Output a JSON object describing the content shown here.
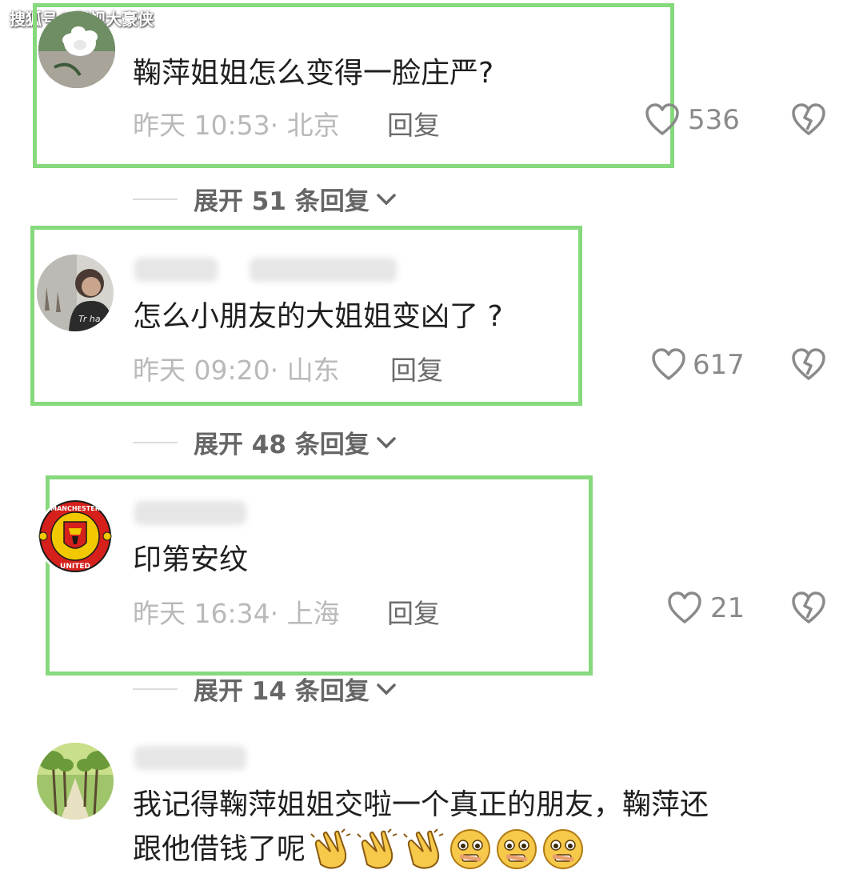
{
  "watermark": "搜狐号@影视大豪侠",
  "comments": [
    {
      "text": "鞠萍姐姐怎么变得一脸庄严?",
      "time": "昨天 10:53",
      "location": "北京",
      "reply_label": "回复",
      "likes": "536",
      "expand_label": "展开 51 条回复",
      "avatar": "white-flower-avatar"
    },
    {
      "text": "怎么小朋友的大姐姐变凶了 ?",
      "time": "昨天 09:20",
      "location": "山东",
      "reply_label": "回复",
      "likes": "617",
      "expand_label": "展开 48 条回复",
      "avatar": "person-photo-avatar"
    },
    {
      "text": "印第安纹",
      "time": "昨天 16:34",
      "location": "上海",
      "reply_label": "回复",
      "likes": "21",
      "expand_label": "展开 14 条回复",
      "avatar": "manchester-united-crest-avatar",
      "crest_top": "MANCHESTER",
      "crest_bottom": "UNITED"
    },
    {
      "line1": "我记得鞠萍姐姐交啦一个真正的朋友，鞠萍还",
      "line2": "跟他借钱了呢",
      "emojis": [
        "clapping-hands-emoji",
        "clapping-hands-emoji",
        "clapping-hands-emoji",
        "flushed-face-emoji",
        "flushed-face-emoji",
        "flushed-face-emoji"
      ],
      "avatar": "tree-road-avatar"
    }
  ],
  "colors": {
    "highlight_box": "#86d97c",
    "meta_text": "#b9b9b9",
    "reply_text": "#6b6b6b"
  }
}
